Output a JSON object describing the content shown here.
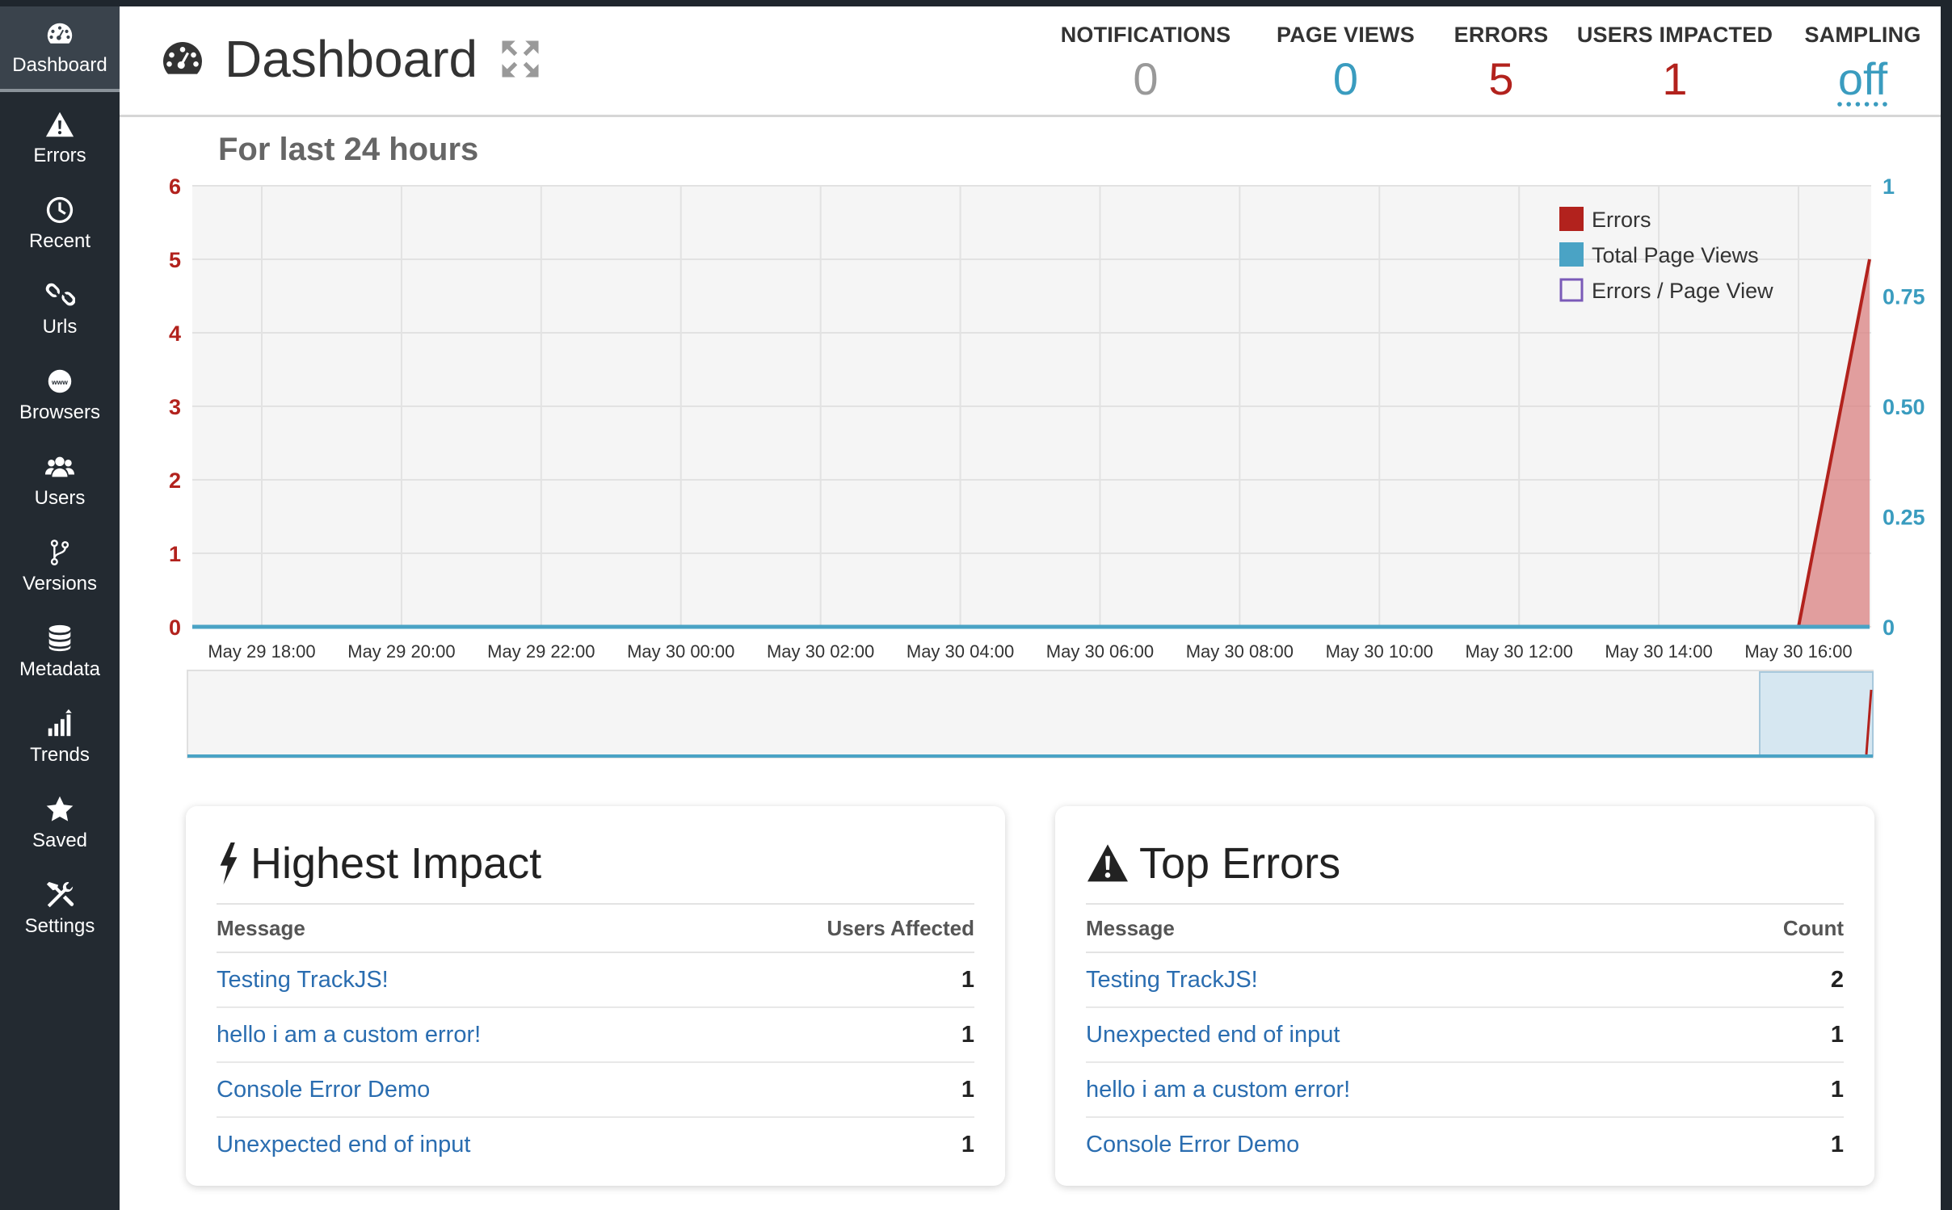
{
  "sidebar": {
    "items": [
      {
        "label": "Dashboard",
        "icon": "dashboard-icon"
      },
      {
        "label": "Errors",
        "icon": "warning-icon"
      },
      {
        "label": "Recent",
        "icon": "clock-icon"
      },
      {
        "label": "Urls",
        "icon": "link-icon"
      },
      {
        "label": "Browsers",
        "icon": "www-icon"
      },
      {
        "label": "Users",
        "icon": "users-icon"
      },
      {
        "label": "Versions",
        "icon": "branch-icon"
      },
      {
        "label": "Metadata",
        "icon": "database-icon"
      },
      {
        "label": "Trends",
        "icon": "trends-icon"
      },
      {
        "label": "Saved",
        "icon": "star-icon"
      },
      {
        "label": "Settings",
        "icon": "settings-icon"
      }
    ]
  },
  "header": {
    "title": "Dashboard",
    "stats": [
      {
        "label": "NOTIFICATIONS",
        "value": "0",
        "color": "#999999"
      },
      {
        "label": "PAGE VIEWS",
        "value": "0",
        "color": "#3a9cbf"
      },
      {
        "label": "ERRORS",
        "value": "5",
        "color": "#b2221d"
      },
      {
        "label": "USERS IMPACTED",
        "value": "1",
        "color": "#b2221d"
      },
      {
        "label": "SAMPLING",
        "value": "off",
        "color": "#3a9cbf"
      }
    ]
  },
  "chart": {
    "title": "For last 24 hours"
  },
  "chart_data": {
    "type": "area",
    "title": "For last 24 hours",
    "x": [
      "May 29 18:00",
      "May 29 20:00",
      "May 29 22:00",
      "May 30 00:00",
      "May 30 02:00",
      "May 30 04:00",
      "May 30 06:00",
      "May 30 08:00",
      "May 30 10:00",
      "May 30 12:00",
      "May 30 14:00",
      "May 30 16:00"
    ],
    "y_left": {
      "ticks": [
        "0",
        "1",
        "2",
        "3",
        "4",
        "5",
        "6"
      ],
      "ylim": [
        0,
        6
      ],
      "color": "#b2221d"
    },
    "y_right": {
      "ticks": [
        "0",
        "0.25",
        "0.50",
        "0.75",
        "1"
      ],
      "ylim": [
        0,
        1
      ],
      "color": "#3a9cbf"
    },
    "series": [
      {
        "name": "Errors",
        "color": "#b2221d",
        "values": [
          0,
          0,
          0,
          0,
          0,
          0,
          0,
          0,
          0,
          0,
          0,
          0,
          5
        ]
      },
      {
        "name": "Total Page Views",
        "color": "#4aa3c5",
        "values": [
          0,
          0,
          0,
          0,
          0,
          0,
          0,
          0,
          0,
          0,
          0,
          0,
          0
        ]
      },
      {
        "name": "Errors / Page View",
        "color": "#7a5ab8",
        "values": []
      }
    ],
    "legend": "top-right",
    "grid": true
  },
  "highest_impact": {
    "title": "Highest Impact",
    "col_message": "Message",
    "col_value": "Users Affected",
    "rows": [
      {
        "message": "Testing TrackJS!",
        "value": "1"
      },
      {
        "message": "hello i am a custom error!",
        "value": "1"
      },
      {
        "message": "Console Error Demo",
        "value": "1"
      },
      {
        "message": "Unexpected end of input",
        "value": "1"
      }
    ]
  },
  "top_errors": {
    "title": "Top Errors",
    "col_message": "Message",
    "col_value": "Count",
    "rows": [
      {
        "message": "Testing TrackJS!",
        "value": "2"
      },
      {
        "message": "Unexpected end of input",
        "value": "1"
      },
      {
        "message": "hello i am a custom error!",
        "value": "1"
      },
      {
        "message": "Console Error Demo",
        "value": "1"
      }
    ]
  }
}
